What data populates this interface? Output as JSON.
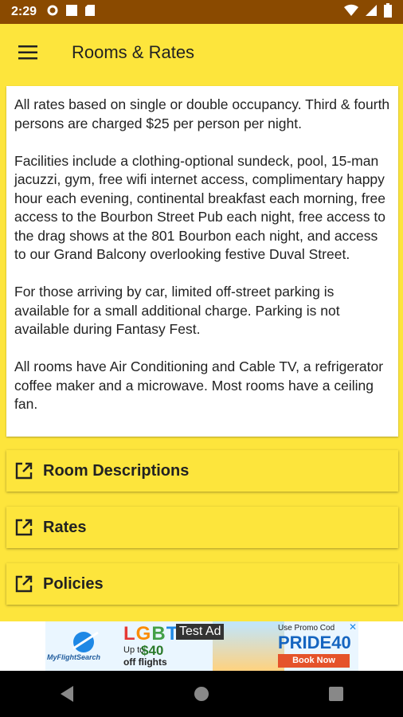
{
  "status_bar": {
    "time": "2:29",
    "icons": [
      "gear-icon",
      "square-icon",
      "sd-card-icon",
      "wifi-icon",
      "signal-icon",
      "battery-icon"
    ]
  },
  "app_bar": {
    "title": "Rooms & Rates",
    "menu_icon": "hamburger-menu-icon"
  },
  "content": {
    "paragraphs": [
      "All rates based on single or double occupancy. Third & fourth persons are charged $25 per person per night.",
      "Facilities include a clothing-optional sundeck, pool, 15-man jacuzzi, gym, free wifi internet access, complimentary happy hour each evening, continental breakfast each morning, free access to the Bourbon Street Pub each night, free access to the drag shows at the 801 Bourbon each night, and access to our Grand Balcony overlooking festive Duval Street.",
      "For those arriving by car, limited off-street parking is available for a small additional charge. Parking is not available during Fantasy Fest.",
      "All rooms have Air Conditioning and Cable TV, a refrigerator coffee maker and a microwave. Most rooms have a ceiling fan."
    ]
  },
  "links": [
    {
      "label": "Room Descriptions",
      "icon": "open-in-new-icon"
    },
    {
      "label": "Rates",
      "icon": "open-in-new-icon"
    },
    {
      "label": "Policies",
      "icon": "open-in-new-icon"
    }
  ],
  "ad": {
    "brand": "MyFlightSearch",
    "headline_letters": [
      "L",
      "G",
      "B",
      "T"
    ],
    "test_label": "Test Ad",
    "up_to": "Up to",
    "price": "$40",
    "off": "off flights",
    "promo_label": "Use Promo Cod",
    "promo_code": "PRIDE40",
    "cta": "Book Now",
    "close": "✕"
  },
  "colors": {
    "status_bar": "#8a4a00",
    "accent_yellow": "#fde53c",
    "text": "#222222"
  },
  "nav": {
    "back_icon": "back-triangle-icon",
    "home_icon": "home-circle-icon",
    "recents_icon": "recents-square-icon"
  }
}
